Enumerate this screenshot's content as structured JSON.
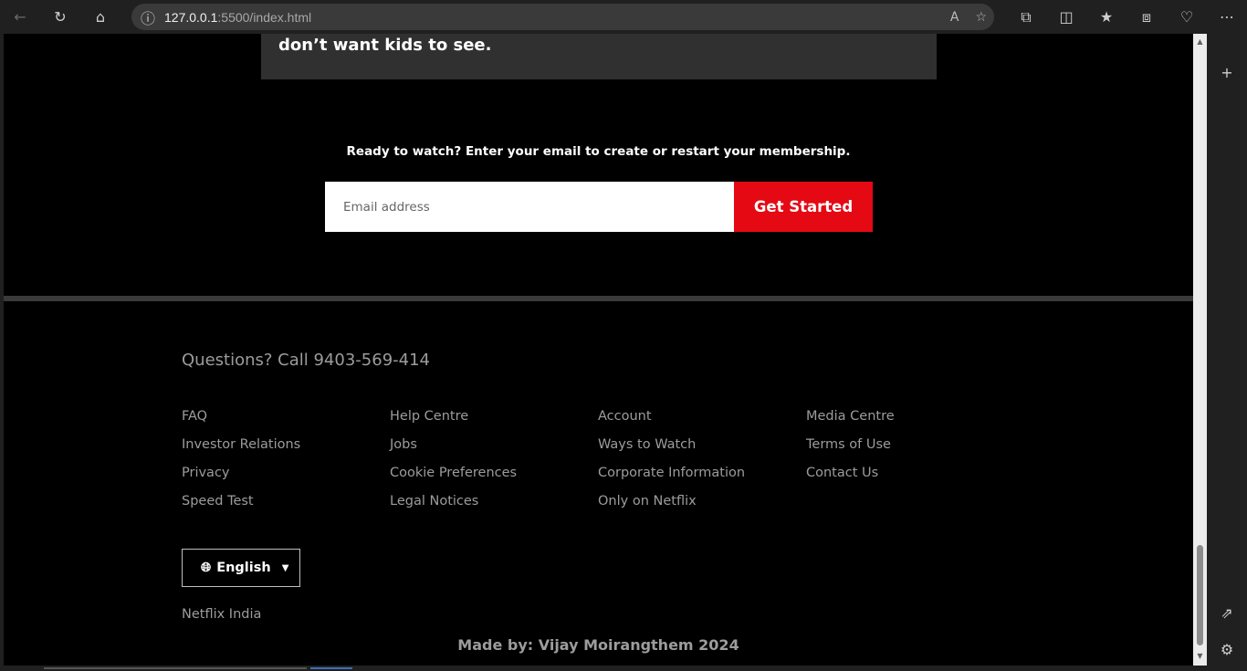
{
  "browser": {
    "url_host": "127.0.0.1",
    "url_path": ":5500/index.html",
    "icons": {
      "back": "←",
      "refresh": "↻",
      "home": "⌂",
      "info": "ⓘ",
      "read_aloud": "A",
      "favorite": "☆",
      "extensions": "⧉",
      "split": "◫",
      "favorites": "★",
      "collections": "⧈",
      "health": "♡",
      "more": "⋯",
      "add": "+",
      "external": "⇗",
      "settings": "⚙"
    }
  },
  "page": {
    "faq_answer_tail": "don’t want kids to see.",
    "ready_text": "Ready to watch? Enter your email to create or restart your membership.",
    "email_placeholder": "Email address",
    "get_started": "Get Started"
  },
  "footer": {
    "call": "Questions? Call 9403-569-414",
    "links": [
      "FAQ",
      "Help Centre",
      "Account",
      "Media Centre",
      "Investor Relations",
      "Jobs",
      "Ways to Watch",
      "Terms of Use",
      "Privacy",
      "Cookie Preferences",
      "Corporate Information",
      "Contact Us",
      "Speed Test",
      "Legal Notices",
      "Only on Netflix"
    ],
    "language": "English",
    "country": "Netflix India",
    "made_by": "Made by: Vijay Moirangthem 2024"
  },
  "colors": {
    "accent": "#e50914",
    "page_bg": "#000000",
    "footer_text": "#9c9c9c"
  }
}
